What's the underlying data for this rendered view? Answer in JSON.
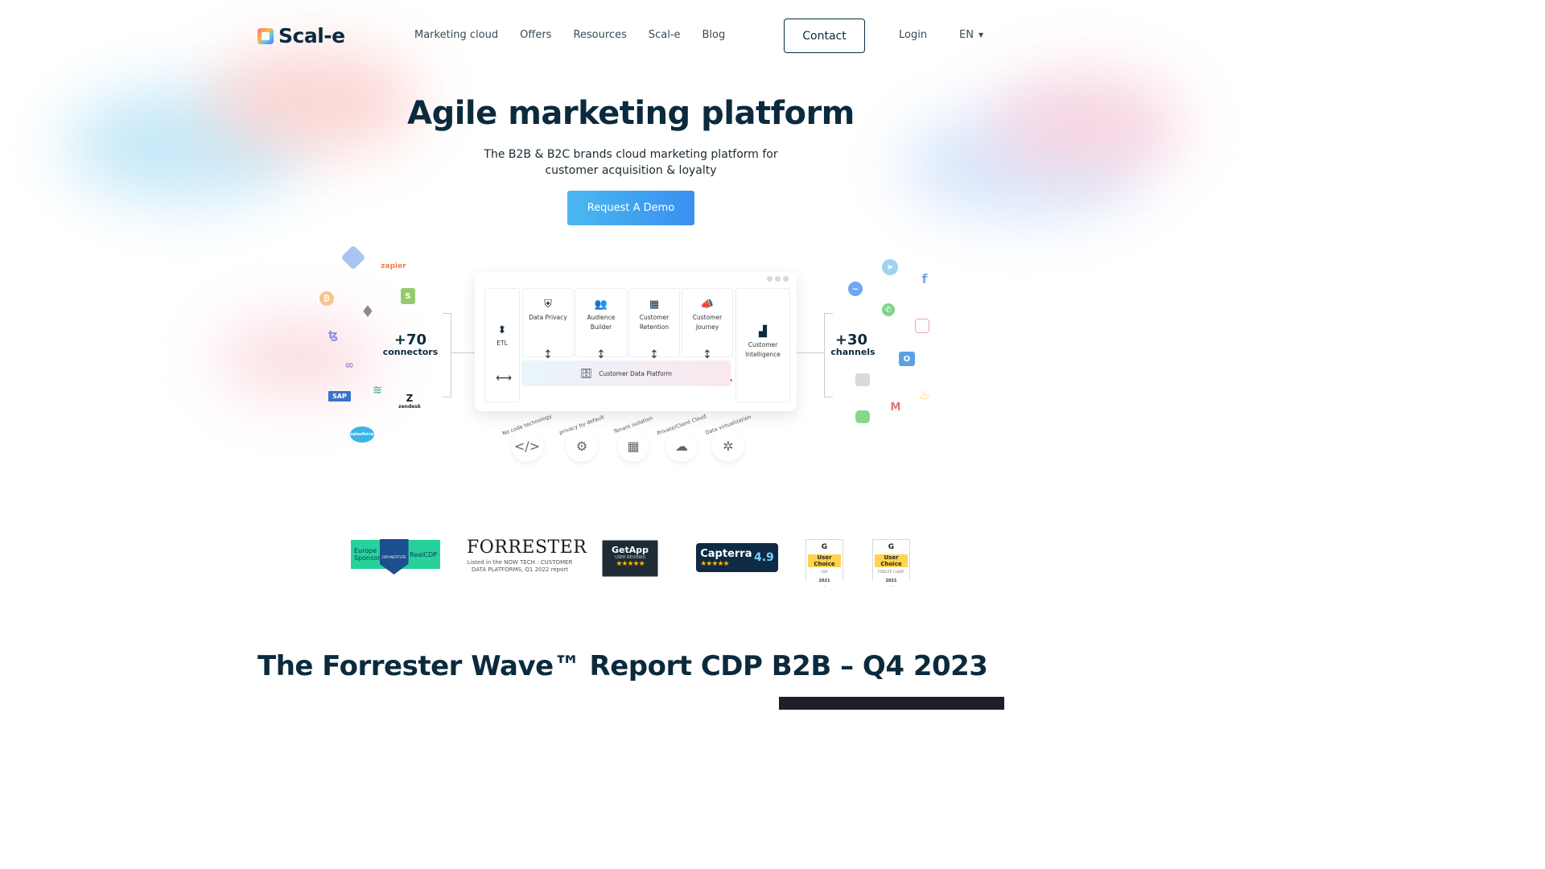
{
  "header": {
    "logo_text": "Scal-e",
    "nav": [
      "Marketing cloud",
      "Offers",
      "Resources",
      "Scal-e",
      "Blog"
    ],
    "contact_label": "Contact",
    "login_label": "Login",
    "language": "EN"
  },
  "hero": {
    "title": "Agile marketing platform",
    "subtitle": "The B2B & B2C brands cloud marketing platform for customer acquisition & loyalty",
    "cta_label": "Request A Demo"
  },
  "diagram": {
    "connectors": {
      "count": "+70",
      "label": "connectors"
    },
    "channels": {
      "count": "+30",
      "label": "channels"
    },
    "connector_apps": [
      "zapier",
      "SAP",
      "zendesk",
      "salesforce"
    ],
    "modules": [
      {
        "label": "Data Privacy",
        "icon": "shield-icon"
      },
      {
        "label": "Audience Builder",
        "icon": "users-icon"
      },
      {
        "label": "Customer Retention",
        "icon": "ticket-icon"
      },
      {
        "label": "Customer Journey",
        "icon": "megaphone-icon"
      }
    ],
    "etl_label": "ETL",
    "intelligence_label": "Customer Intelligence",
    "cdp_label": "Customer Data Platform",
    "features": [
      "No code technology",
      "privacy by default",
      "Tenant isolation",
      "Private/Client Cloud",
      "Data virtualization"
    ]
  },
  "badges": {
    "cdp": {
      "left": "Europe Sponsor",
      "center": "CDP INSTITUTE",
      "right": "RealCDP"
    },
    "forrester": {
      "name": "FORRESTER",
      "note": "Listed in the NOW TECH : CUSTOMER DATA PLATFORMS, Q1 2022 report"
    },
    "getapp": {
      "name": "GetApp",
      "sub": "USER REVIEWS"
    },
    "capterra": {
      "name": "Capterra",
      "rating": "4.9"
    },
    "g2": [
      {
        "title": "User Choice",
        "sub": "CDP",
        "year": "2021"
      },
      {
        "title": "User Choice",
        "sub": "FIDELITÉ CLIENT",
        "year": "2021"
      }
    ]
  },
  "section": {
    "title": "The Forrester Wave™ Report CDP B2B – Q4 2023"
  }
}
